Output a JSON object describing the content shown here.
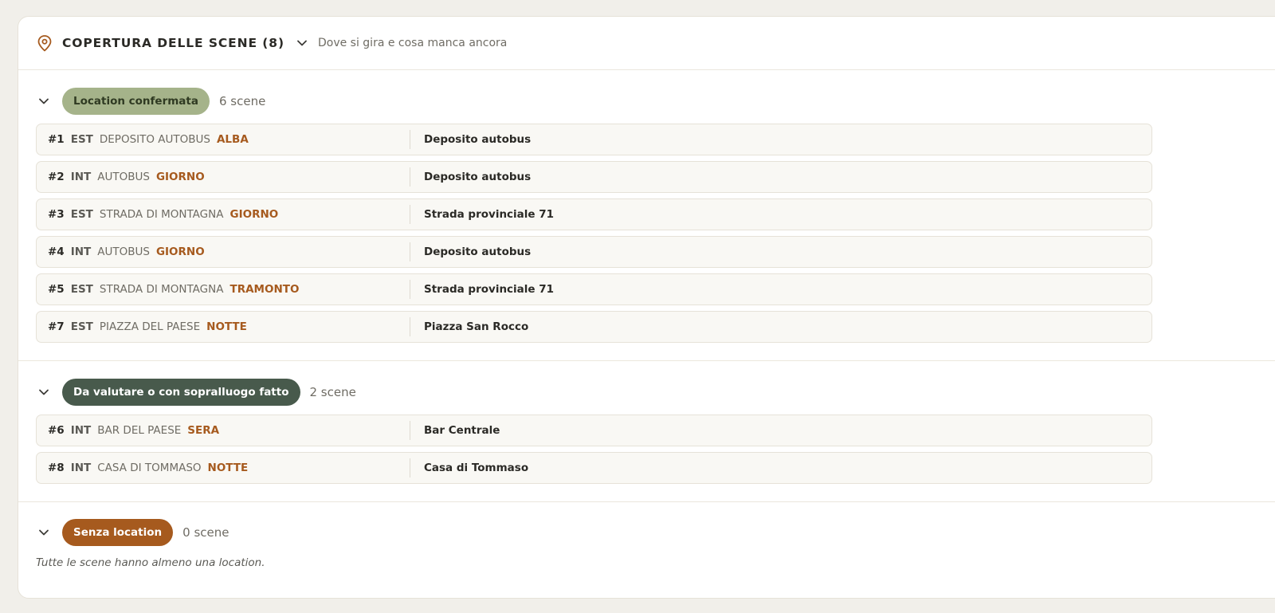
{
  "header": {
    "title": "COPERTURA DELLE SCENE (8)",
    "subtitle": "Dove si gira e cosa manca ancora",
    "icon": "map-pin-icon"
  },
  "colors": {
    "confirmed_badge": "#a5b38a",
    "pending_badge": "#485a4c",
    "none_badge": "#a65a1e",
    "time_of_day": "#a65a1e"
  },
  "groups": {
    "confirmed": {
      "label": "Location confermata",
      "count": "6 scene",
      "scenes": [
        {
          "num": "#1",
          "ie": "EST",
          "place": "DEPOSITO AUTOBUS",
          "time": "ALBA",
          "location": "Deposito autobus"
        },
        {
          "num": "#2",
          "ie": "INT",
          "place": "AUTOBUS",
          "time": "GIORNO",
          "location": "Deposito autobus"
        },
        {
          "num": "#3",
          "ie": "EST",
          "place": "STRADA DI MONTAGNA",
          "time": "GIORNO",
          "location": "Strada provinciale 71"
        },
        {
          "num": "#4",
          "ie": "INT",
          "place": "AUTOBUS",
          "time": "GIORNO",
          "location": "Deposito autobus"
        },
        {
          "num": "#5",
          "ie": "EST",
          "place": "STRADA DI MONTAGNA",
          "time": "TRAMONTO",
          "location": "Strada provinciale 71"
        },
        {
          "num": "#7",
          "ie": "EST",
          "place": "PIAZZA DEL PAESE",
          "time": "NOTTE",
          "location": "Piazza San Rocco"
        }
      ]
    },
    "pending": {
      "label": "Da valutare o con sopralluogo fatto",
      "count": "2 scene",
      "scenes": [
        {
          "num": "#6",
          "ie": "INT",
          "place": "BAR DEL PAESE",
          "time": "SERA",
          "location": "Bar Centrale"
        },
        {
          "num": "#8",
          "ie": "INT",
          "place": "CASA DI TOMMASO",
          "time": "NOTTE",
          "location": "Casa di Tommaso"
        }
      ]
    },
    "none": {
      "label": "Senza location",
      "count": "0 scene",
      "empty_text": "Tutte le scene hanno almeno una location."
    }
  }
}
